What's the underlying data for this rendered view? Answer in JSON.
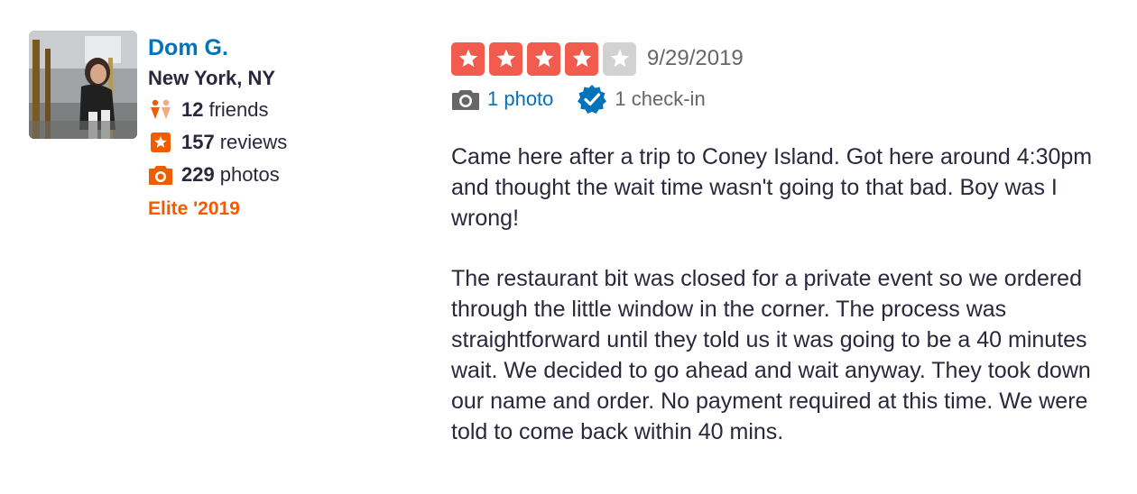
{
  "user": {
    "name": "Dom G.",
    "location": "New York, NY",
    "friends_count": "12",
    "friends_label": "friends",
    "reviews_count": "157",
    "reviews_label": "reviews",
    "photos_count": "229",
    "photos_label": "photos",
    "elite": "Elite '2019"
  },
  "review": {
    "rating": 4,
    "rating_max": 5,
    "date": "9/29/2019",
    "photo_link": "1 photo",
    "checkin": "1 check-in",
    "paragraphs": [
      "Came here after a trip to Coney Island. Got here around 4:30pm and thought the wait time wasn't going to that bad. Boy was I wrong!",
      "The restaurant bit was closed for a private event so we ordered through the little window in the corner. The process was straightforward until they told us it was going to be a 40 minutes wait. We decided to go ahead and wait anyway. They took down our name and order. No payment required at this time. We were told to come back within 40 mins."
    ]
  },
  "colors": {
    "star_filled": "#f15c4f",
    "star_empty": "#d2d2d2",
    "link_blue": "#0073bb",
    "elite_orange": "#f15c00",
    "stat_icon_orange": "#f15c00"
  },
  "icons": {
    "friends": "friends-icon",
    "reviews": "star-badge-icon",
    "photos": "camera-icon",
    "photo": "camera-icon",
    "checkin": "verified-check-icon"
  }
}
